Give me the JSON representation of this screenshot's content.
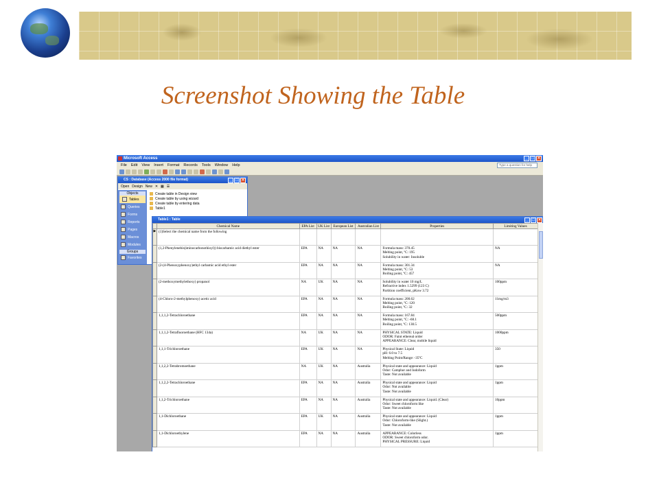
{
  "slide": {
    "title": "Screenshot Showing the Table"
  },
  "app": {
    "title": "Microsoft Access",
    "menu": [
      "File",
      "Edit",
      "View",
      "Insert",
      "Format",
      "Records",
      "Tools",
      "Window",
      "Help"
    ],
    "help_placeholder": "Type a question for help"
  },
  "db_window": {
    "title": "CS : Database (Access 2000 file format)",
    "toolbar": [
      "Open",
      "Design",
      "New"
    ],
    "objects_header": "Objects",
    "objects": [
      "Tables",
      "Queries",
      "Forms",
      "Reports",
      "Pages",
      "Macros",
      "Modules"
    ],
    "groups_header": "Groups",
    "groups": [
      "Favorites"
    ],
    "items": [
      "Create table in Design view",
      "Create table by using wizard",
      "Create table by entering data",
      "Table1"
    ]
  },
  "table_window": {
    "title": "Table1 : Table",
    "columns": [
      "Chemical Name",
      "EPA List",
      "UK List",
      "European List",
      "Australian List",
      "Properties",
      "Limiting Values"
    ],
    "rows": [
      [
        "(1)Select the chemical name from the following",
        "",
        "",
        "",
        "",
        "",
        ""
      ],
      [
        "(1,2-Phenylenebis(iminocarbonothioyl)) biscarbamic acid diethyl ester",
        "EPA",
        "NA",
        "NA",
        "NA",
        "Formula mass: 370.45\nMelting point, ºC: 195\nSolubility in water: Insoluble",
        "NA"
      ],
      [
        "(2-(4-Phenoxyphenoxy)ethyl carbamic acid ethyl ester",
        "EPA",
        "NA",
        "NA",
        "NA",
        "Formula mass: 301.34\nMelting point, ºC: 53\nBoiling point, ºC: 457",
        "NA"
      ],
      [
        "(2-methoxymethylethoxy) propanol",
        "NA",
        "UK",
        "NA",
        "NA",
        "Solubility in water 10 mg/L\nRefractive index 1.5299 (123 C)\nPartition coefficient, pKow 3.72",
        "100ppm"
      ],
      [
        "(4-Chloro-2-methylphenoxy) acetic acid",
        "EPA",
        "NA",
        "NA",
        "NA",
        "Formula mass: 200.62\nMelting point, ºC: 120\nBoiling point, ºC: 32",
        "11mg/m3"
      ],
      [
        "1,1,1,2-Tetrachloroethane",
        "EPA",
        "NA",
        "NA",
        "NA",
        "Formula mass: 167.84\nMelting point, ºC: -68.1\nBoiling point, ºC: 130.5",
        "500ppm"
      ],
      [
        "1,1,1,2-Tetrafluoroethane (HFC 134a)",
        "NA",
        "UK",
        "NA",
        "NA",
        "PHYSICAL STATE: Liquid\nODOR: Faint ethereal order\nAPPEARANCE: Clear, mobile liquid",
        "1000ppm"
      ],
      [
        "1,1,1-Trichloroethane",
        "EPA",
        "UK",
        "NA",
        "NA",
        "Physical State: Liquid\npH: 6.0 to 7.5\nMelting Point/Range: -35ºC",
        "350"
      ],
      [
        "1,1,2,2-Tetrabromoethane",
        "NA",
        "UK",
        "NA",
        "Australia",
        "Physical state and appearance: Liquid\nOdor: Camphor and Iodoform\nTaste: Not available",
        "1ppm"
      ],
      [
        "1,1,2,2-Tetrachloroethane",
        "EPA",
        "NA",
        "NA",
        "Australia",
        "Physical state and appearance: Liquid\nOdor: Not available\nTaste: Not available",
        "1ppm"
      ],
      [
        "1,1,2-Trichloroethane",
        "EPA",
        "NA",
        "NA",
        "Australia",
        "Physical state and appearance: Liquid. (Clear)\nOdor: Sweet chloroform like\nTaste: Not available",
        "10ppm"
      ],
      [
        "1,1-Dichloroethane",
        "EPA",
        "UK",
        "NA",
        "Australia",
        "Physical state and appearance: Liquid\nOdor: Chloroform-like (Slight.)\nTaste: Not available",
        "1ppm"
      ],
      [
        "1,1-Dichloroethylene",
        "EPA",
        "NA",
        "NA",
        "Australia",
        "APPEARANCE: Colorless\nODOR: Sweet chloroform odor.\nPHYSICAL PRESSURE: Liquid",
        "1ppm"
      ]
    ]
  }
}
